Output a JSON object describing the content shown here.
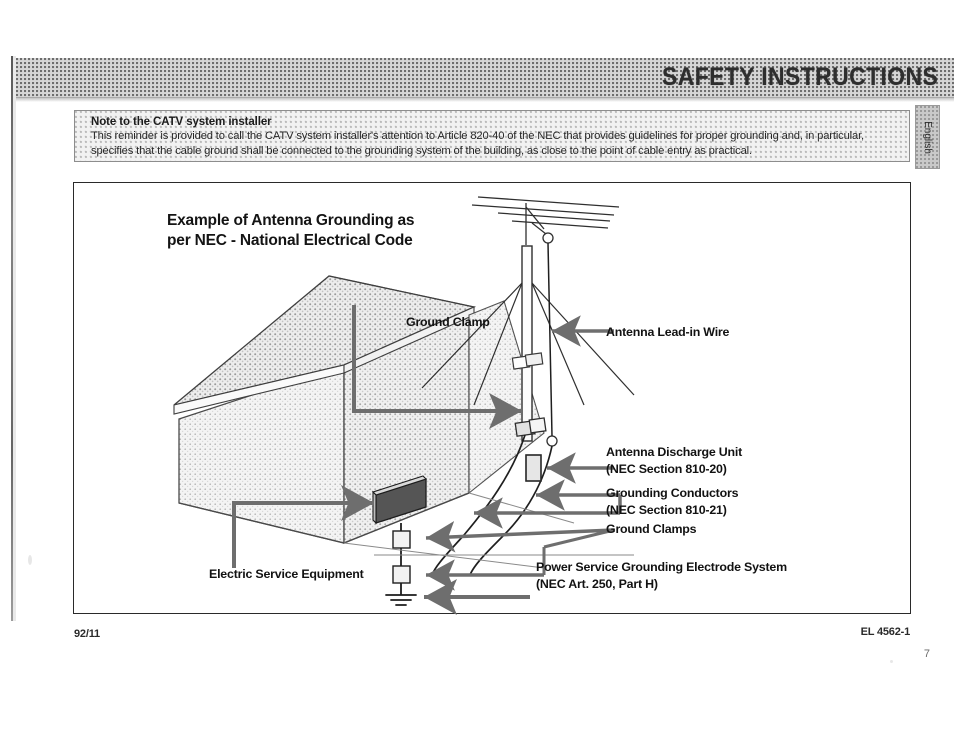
{
  "header": {
    "title": "SAFETY INSTRUCTIONS",
    "side_tab": "English"
  },
  "note": {
    "title": "Note to the CATV system installer",
    "line1": "This reminder is provided to call the CATV system installer's attention to Article 820-40 of the NEC that provides guidelines for proper grounding and, in particular,",
    "line2": "specifies that the cable ground shall be connected to the grounding system of the building, as close to the point of cable entry as practical."
  },
  "diagram": {
    "title_line1": "Example of Antenna Grounding as",
    "title_line2": "per NEC - National Electrical Code",
    "labels": {
      "ground_clamp": "Ground Clamp",
      "antenna_lead_in_wire": "Antenna Lead-in Wire",
      "antenna_discharge_unit": "Antenna Discharge Unit",
      "antenna_discharge_unit_sub": "(NEC Section 810-20)",
      "grounding_conductors": "Grounding Conductors",
      "grounding_conductors_sub": "(NEC Section 810-21)",
      "ground_clamps": "Ground Clamps",
      "electric_service_equipment": "Electric Service Equipment",
      "power_service": "Power Service Grounding Electrode System",
      "power_service_sub": "(NEC Art. 250, Part H)"
    }
  },
  "footer": {
    "left_code": "92/11",
    "right_code": "EL 4562-1",
    "page_number": "7"
  },
  "colors": {
    "ink": "#141414",
    "band": "#d6d6d6",
    "arrow": "#6e6e6e",
    "line": "#3a3a3a"
  }
}
